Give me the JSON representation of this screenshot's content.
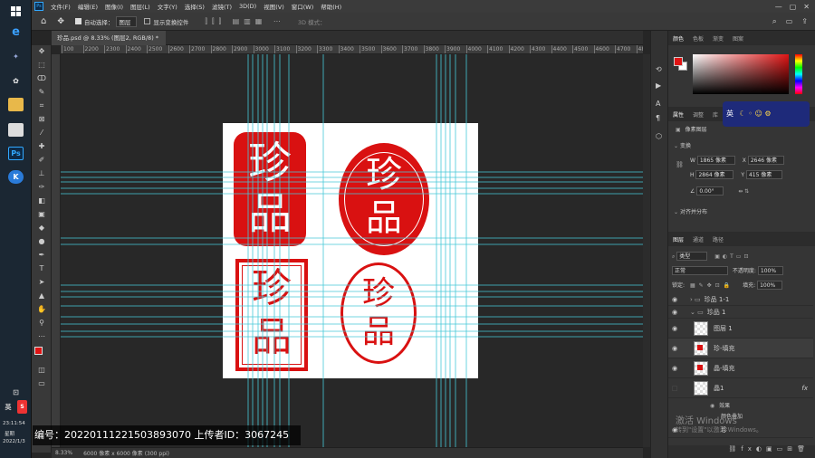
{
  "taskbar": {
    "time": "23:11:54",
    "weekday": "星期",
    "date": "2022/1/3",
    "ime": "英"
  },
  "menu": [
    "文件(F)",
    "编辑(E)",
    "图像(I)",
    "图层(L)",
    "文字(Y)",
    "选择(S)",
    "滤镜(T)",
    "3D(D)",
    "视图(V)",
    "窗口(W)",
    "帮助(H)"
  ],
  "options": {
    "auto_select": "自动选择：",
    "target": "图层",
    "transform": "显示变换控件",
    "mode": "3D 模式："
  },
  "document": {
    "tab": "珍品.psd @ 8.33% (图层2, RGB/8) *"
  },
  "ruler": {
    "ticks": [
      "100",
      "2200",
      "2300",
      "2400",
      "2500",
      "2600",
      "2700",
      "2800",
      "2900",
      "3000",
      "3100",
      "3200",
      "3300",
      "3400",
      "3500",
      "3600",
      "3700",
      "3800",
      "3900",
      "4000",
      "4100",
      "4200",
      "4300",
      "4400",
      "4500",
      "4600",
      "4700",
      "4800"
    ]
  },
  "canvas": {
    "stamp_chars": [
      "珍",
      "品"
    ]
  },
  "status": {
    "zoom": "8.33%",
    "info": "6000 像素 x 6000 像素 (300 ppi)"
  },
  "color_panel": {
    "tabs": [
      "颜色",
      "色板",
      "渐变",
      "图案"
    ],
    "fg": "#e01414",
    "bg": "#ffffff"
  },
  "props": {
    "tabs": [
      "属性",
      "调整",
      "库"
    ],
    "kind": "像素图层",
    "transform_title": "变换",
    "w": "1865 像素",
    "x": "2646 像素",
    "h": "2864 像素",
    "y": "415 像素",
    "angle": "0.00°",
    "align_title": "对齐并分布"
  },
  "ime_bar": {
    "label": "英"
  },
  "layers_panel": {
    "tabs": [
      "图层",
      "通道",
      "路径"
    ],
    "kind": "类型",
    "blend": "正常",
    "opacity_label": "不透明度:",
    "opacity": "100%",
    "lock_label": "锁定:",
    "fill_label": "填充:",
    "fill": "100%",
    "layers": [
      {
        "name": "珍品 1-1",
        "type": "group",
        "visible": true
      },
      {
        "name": "珍品 1",
        "type": "group",
        "visible": true
      },
      {
        "name": "图层 1",
        "type": "layer",
        "visible": true
      },
      {
        "name": "珍-填充",
        "type": "layer",
        "visible": true
      },
      {
        "name": "晶-填充",
        "type": "layer",
        "visible": true
      },
      {
        "name": "晶1",
        "type": "layer",
        "visible": false,
        "fx": "fx"
      }
    ],
    "effects": "效果",
    "effect_item": "颜色叠加",
    "last_layer": "珍"
  },
  "windows_activation": {
    "line1": "激活 Windows",
    "line2": "转到\"设置\"以激活 Windows。"
  },
  "watermark": "编号：20220111221503893070 上传者ID：3067245"
}
